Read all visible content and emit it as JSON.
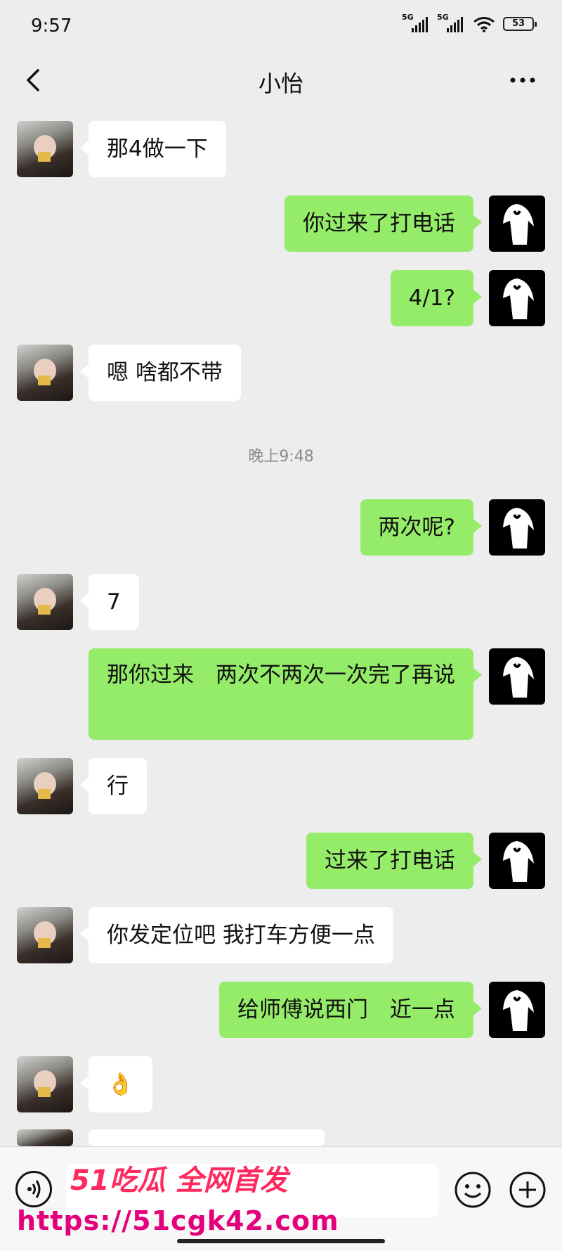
{
  "status_bar": {
    "time": "9:57",
    "signal1_label": "5G",
    "signal2_label": "5G",
    "battery": "53"
  },
  "header": {
    "title": "小怡"
  },
  "messages": [
    {
      "side": "left",
      "text": "那4做一下"
    },
    {
      "side": "right",
      "text": "你过来了打电话"
    },
    {
      "side": "right",
      "text": "4/1?"
    },
    {
      "side": "left",
      "text": "嗯 啥都不带"
    },
    {
      "side": "right",
      "text": "两次呢?"
    },
    {
      "side": "left",
      "text": "7"
    },
    {
      "side": "right",
      "text": "那你过来　两次不两次一次完了再说"
    },
    {
      "side": "left",
      "text": "行"
    },
    {
      "side": "right",
      "text": "过来了打电话"
    },
    {
      "side": "left",
      "text": "你发定位吧 我打车方便一点"
    },
    {
      "side": "right",
      "text": "给师傅说西门　近一点"
    },
    {
      "side": "left",
      "text": "👌"
    }
  ],
  "time_divider": "晚上9:48",
  "watermark": {
    "brand": "51吃瓜 全网首发",
    "url": "https://51cgk42.com"
  },
  "colors": {
    "background": "#ededed",
    "bubble_self": "#95ec69",
    "bubble_other": "#ffffff",
    "watermark": "#e4007a"
  }
}
